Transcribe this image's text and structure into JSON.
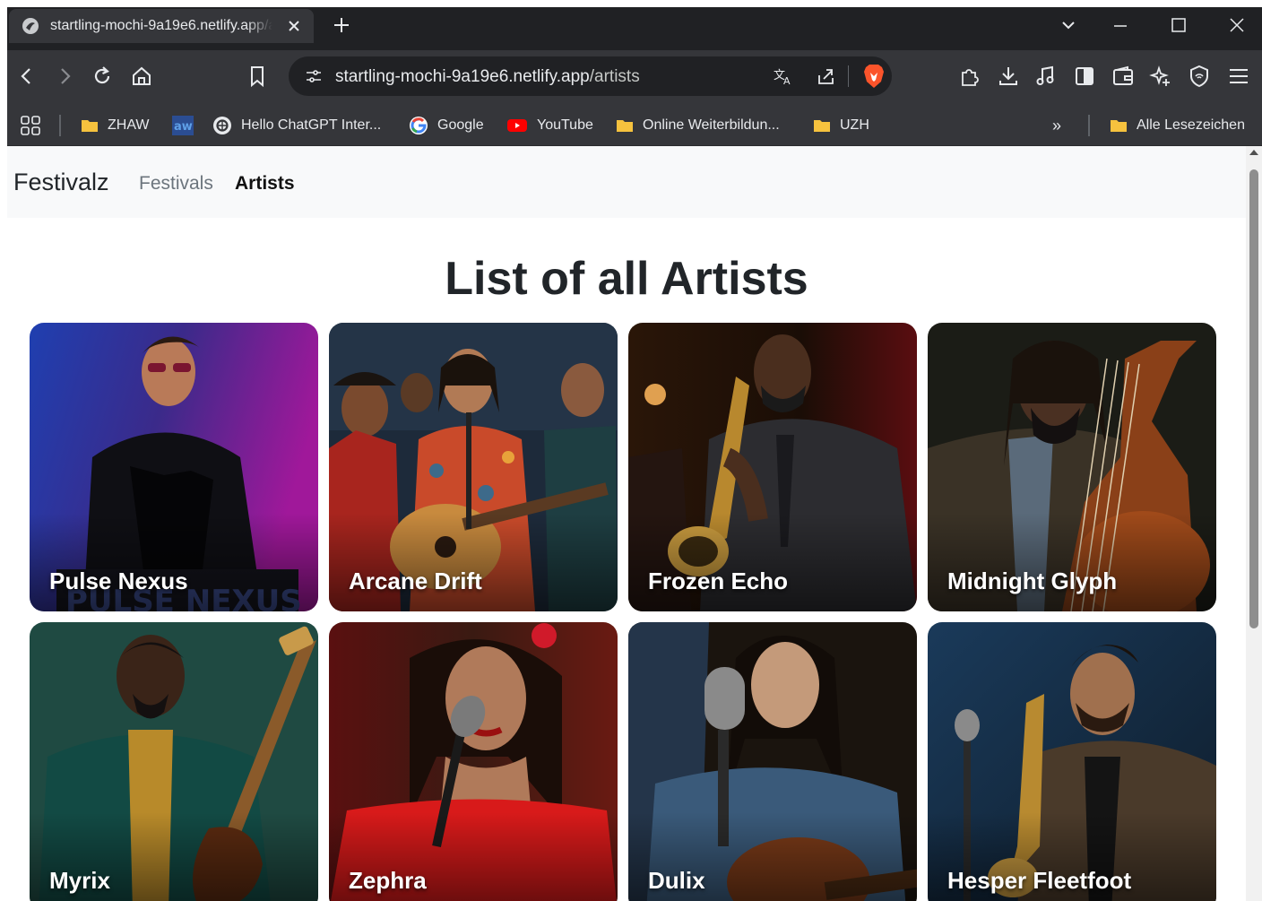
{
  "browser": {
    "tab_title": "startling-mochi-9a19e6.netlify.app/artists",
    "url_host": "startling-mochi-9a19e6.netlify.app",
    "url_path": "/artists",
    "accent": "#fb542b"
  },
  "bookmarks": {
    "items": [
      {
        "label": "ZHAW",
        "icon": "folder-icon"
      },
      {
        "label": "",
        "icon": "aw-logo-icon"
      },
      {
        "label": "Hello ChatGPT Inter...",
        "icon": "openai-icon"
      },
      {
        "label": "Google",
        "icon": "google-icon"
      },
      {
        "label": "YouTube",
        "icon": "youtube-icon"
      },
      {
        "label": "Online Weiterbildun...",
        "icon": "folder-icon"
      },
      {
        "label": "UZH",
        "icon": "folder-icon"
      }
    ],
    "overflow": "»",
    "all_bookmarks": "Alle Lesezeichen"
  },
  "site": {
    "brand": "Festivalz",
    "nav": [
      {
        "label": "Festivals",
        "active": false
      },
      {
        "label": "Artists",
        "active": true
      }
    ],
    "heading": "List of all Artists"
  },
  "artists": [
    {
      "name": "Pulse Nexus"
    },
    {
      "name": "Arcane Drift"
    },
    {
      "name": "Frozen Echo"
    },
    {
      "name": "Midnight Glyph"
    },
    {
      "name": "Myrix"
    },
    {
      "name": "Zephra"
    },
    {
      "name": "Dulix"
    },
    {
      "name": "Hesper Fleetfoot"
    }
  ]
}
